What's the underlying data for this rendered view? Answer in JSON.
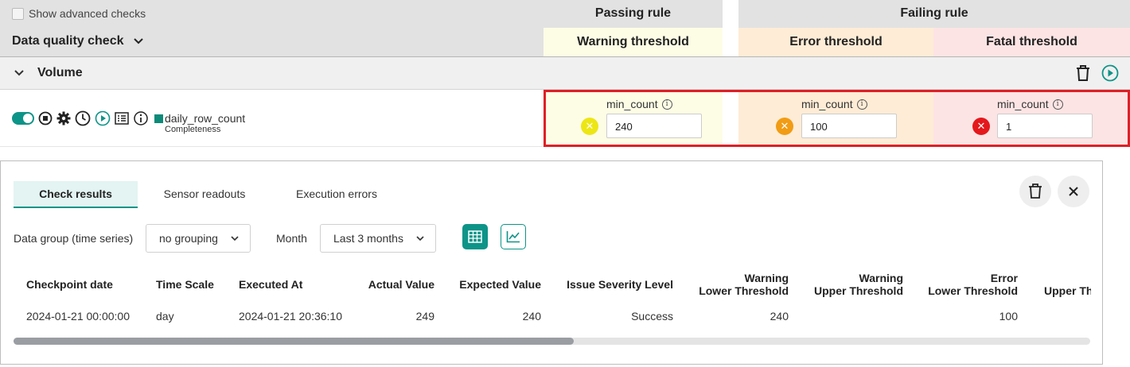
{
  "header": {
    "advanced_checks_label": "Show advanced checks",
    "data_quality_check_label": "Data quality check",
    "passing_rule": "Passing rule",
    "failing_rule": "Failing rule",
    "warning_threshold": "Warning threshold",
    "error_threshold": "Error threshold",
    "fatal_threshold": "Fatal threshold"
  },
  "group": {
    "label": "Volume"
  },
  "check": {
    "name": "daily_row_count",
    "category": "Completeness",
    "enabled": true
  },
  "rules": {
    "warning": {
      "label": "min_count",
      "value": "240"
    },
    "error": {
      "label": "min_count",
      "value": "100"
    },
    "fatal": {
      "label": "min_count",
      "value": "1"
    }
  },
  "results_panel": {
    "tabs": [
      "Check results",
      "Sensor readouts",
      "Execution errors"
    ],
    "active_tab": "Check results",
    "data_group_label": "Data group (time series)",
    "data_group_value": "no grouping",
    "month_label": "Month",
    "month_value": "Last 3 months",
    "columns": {
      "checkpoint_date": "Checkpoint date",
      "time_scale": "Time Scale",
      "executed_at": "Executed At",
      "actual_value": "Actual Value",
      "expected_value": "Expected Value",
      "issue_severity": "Issue Severity Level",
      "warning_lower_1": "Warning",
      "warning_lower_2": "Lower Threshold",
      "warning_upper_1": "Warning",
      "warning_upper_2": "Upper Threshold",
      "error_lower_1": "Error",
      "error_lower_2": "Lower Threshold",
      "error_upper_partial": "Upper Th"
    },
    "rows": [
      {
        "checkpoint_date": "2024-01-21 00:00:00",
        "time_scale": "day",
        "executed_at": "2024-01-21 20:36:10",
        "actual_value": "249",
        "expected_value": "240",
        "issue_severity": "Success",
        "warning_lower": "240",
        "warning_upper": "",
        "error_lower": "100"
      }
    ],
    "scroll_position": 0.52
  },
  "colors": {
    "accent": "#0d9488",
    "warning": "#ede615",
    "error": "#f19c14",
    "fatal": "#e4181c",
    "highlight_box": "#e01f26"
  },
  "icons": [
    "checkbox-icon",
    "chevron-down-icon",
    "trash-icon",
    "play-icon",
    "toggle-icon",
    "stop-icon",
    "gear-icon",
    "clock-icon",
    "list-icon",
    "info-icon",
    "close-icon",
    "table-icon",
    "chart-icon"
  ]
}
